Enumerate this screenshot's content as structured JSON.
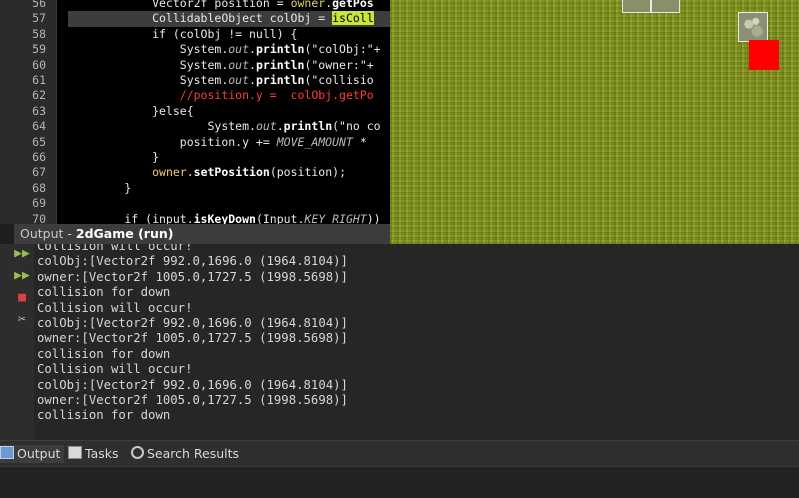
{
  "editor": {
    "lines": [
      {
        "num": "56",
        "parts": [
          {
            "c": "tx",
            "t": "            Vector2f position = "
          },
          {
            "c": "co",
            "t": "owner"
          },
          {
            "c": "tx",
            "t": "."
          },
          {
            "c": "fn",
            "t": "getPos"
          }
        ]
      },
      {
        "num": "57",
        "highlight": true,
        "parts": [
          {
            "c": "tx",
            "t": "            CollidableObject colObj = "
          },
          {
            "c": "sel",
            "t": "isColl"
          }
        ]
      },
      {
        "num": "58",
        "parts": [
          {
            "c": "tx",
            "t": "            if (colObj != null) {"
          }
        ]
      },
      {
        "num": "59",
        "parts": [
          {
            "c": "tx",
            "t": "                System."
          },
          {
            "c": "it",
            "t": "out"
          },
          {
            "c": "tx",
            "t": "."
          },
          {
            "c": "fn",
            "t": "println"
          },
          {
            "c": "str",
            "t": "(\"colObj:\"+"
          }
        ]
      },
      {
        "num": "60",
        "parts": [
          {
            "c": "tx",
            "t": "                System."
          },
          {
            "c": "it",
            "t": "out"
          },
          {
            "c": "tx",
            "t": "."
          },
          {
            "c": "fn",
            "t": "println"
          },
          {
            "c": "str",
            "t": "(\"owner:\"+"
          }
        ]
      },
      {
        "num": "61",
        "parts": [
          {
            "c": "tx",
            "t": "                System."
          },
          {
            "c": "it",
            "t": "out"
          },
          {
            "c": "tx",
            "t": "."
          },
          {
            "c": "fn",
            "t": "println"
          },
          {
            "c": "str",
            "t": "(\"collisio"
          }
        ]
      },
      {
        "num": "62",
        "parts": [
          {
            "c": "cm",
            "t": "                //position.y =  colObj.getPo"
          }
        ]
      },
      {
        "num": "63",
        "parts": [
          {
            "c": "tx",
            "t": "            }else{"
          }
        ]
      },
      {
        "num": "64",
        "parts": [
          {
            "c": "tx",
            "t": "                    System."
          },
          {
            "c": "it",
            "t": "out"
          },
          {
            "c": "tx",
            "t": "."
          },
          {
            "c": "fn",
            "t": "println"
          },
          {
            "c": "str",
            "t": "(\"no co"
          }
        ]
      },
      {
        "num": "65",
        "parts": [
          {
            "c": "tx",
            "t": "                position.y += "
          },
          {
            "c": "it",
            "t": "MOVE_AMOUNT"
          },
          {
            "c": "tx",
            "t": " *"
          }
        ]
      },
      {
        "num": "66",
        "parts": [
          {
            "c": "tx",
            "t": "            }"
          }
        ]
      },
      {
        "num": "67",
        "parts": [
          {
            "c": "tx",
            "t": "            "
          },
          {
            "c": "co",
            "t": "owner"
          },
          {
            "c": "tx",
            "t": "."
          },
          {
            "c": "fn",
            "t": "setPosition"
          },
          {
            "c": "tx",
            "t": "(position);"
          }
        ]
      },
      {
        "num": "68",
        "parts": [
          {
            "c": "tx",
            "t": "        }"
          }
        ]
      },
      {
        "num": "69",
        "parts": [
          {
            "c": "tx",
            "t": ""
          }
        ]
      },
      {
        "num": "70",
        "parts": [
          {
            "c": "tx",
            "t": "        if (input."
          },
          {
            "c": "fn",
            "t": "isKeyDown"
          },
          {
            "c": "tx",
            "t": "(Input."
          },
          {
            "c": "it",
            "t": "KEY_RIGHT"
          },
          {
            "c": "tx",
            "t": "))"
          }
        ]
      }
    ]
  },
  "output": {
    "title_prefix": "Output - ",
    "title_bold": "2dGame (run)",
    "lines": [
      "Collision will occur!",
      "colObj:[Vector2f 992.0,1696.0 (1964.8104)]",
      "owner:[Vector2f 1005.0,1727.5 (1998.5698)]",
      "collision for down",
      "Collision will occur!",
      "colObj:[Vector2f 992.0,1696.0 (1964.8104)]",
      "owner:[Vector2f 1005.0,1727.5 (1998.5698)]",
      "collision for down",
      "Collision will occur!",
      "colObj:[Vector2f 992.0,1696.0 (1964.8104)]",
      "owner:[Vector2f 1005.0,1727.5 (1998.5698)]",
      "collision for down"
    ],
    "toolbar": {
      "rerun_icon": "double-play-icon",
      "stop_icon": "stop-icon",
      "settings_icon": "tools-icon"
    }
  },
  "bottom_tabs": {
    "output_label": "Output",
    "tasks_label": "Tasks",
    "search_label": "Search Results"
  },
  "colors": {
    "player": "#ff0000",
    "grass": "#8a9a2a",
    "selection": "#c9e43e"
  }
}
